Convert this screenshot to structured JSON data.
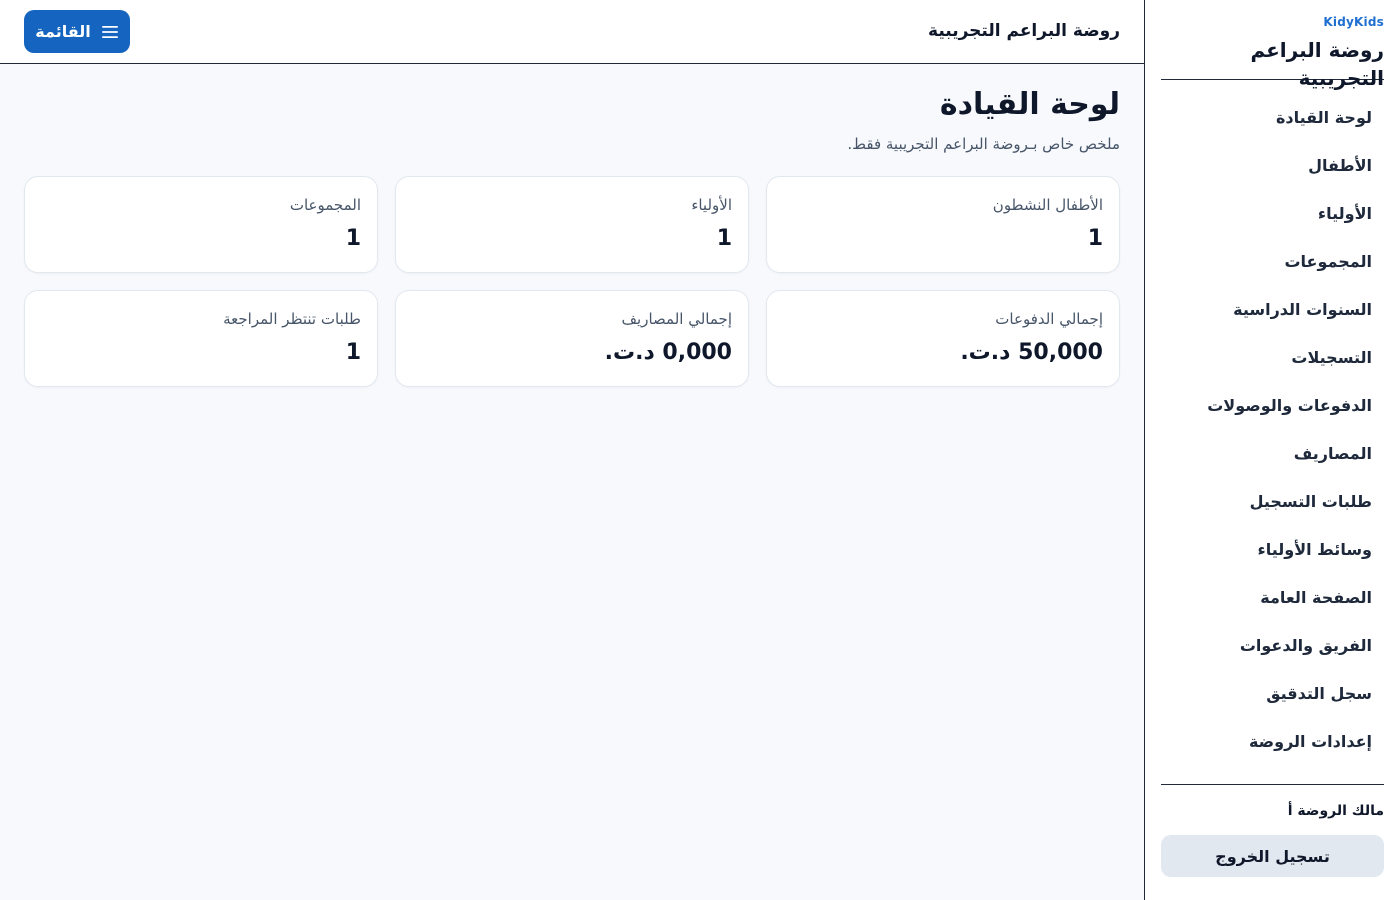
{
  "sidebar": {
    "brand_mark": "KidyKids",
    "brand_name": "روضة البراعم التجريبية",
    "items": [
      {
        "label": "لوحة القيادة"
      },
      {
        "label": "الأطفال"
      },
      {
        "label": "الأولياء"
      },
      {
        "label": "المجموعات"
      },
      {
        "label": "السنوات الدراسية"
      },
      {
        "label": "التسجيلات"
      },
      {
        "label": "الدفوعات والوصولات"
      },
      {
        "label": "المصاريف"
      },
      {
        "label": "طلبات التسجيل"
      },
      {
        "label": "وسائط الأولياء"
      },
      {
        "label": "الصفحة العامة"
      },
      {
        "label": "الفريق والدعوات"
      },
      {
        "label": "سجل التدقيق"
      },
      {
        "label": "إعدادات الروضة"
      }
    ],
    "owner": "مالك الروضة أ",
    "logout_label": "تسجيل الخروج"
  },
  "topbar": {
    "title": "روضة البراعم التجريبية",
    "menu_label": "القائمة",
    "menu_icon": "hamburger-icon"
  },
  "main": {
    "title": "لوحة القيادة",
    "subtitle": "ملخص خاص بـروضة البراعم التجريبية فقط.",
    "cards": [
      {
        "label": "الأطفال النشطون",
        "value": "1"
      },
      {
        "label": "الأولياء",
        "value": "1"
      },
      {
        "label": "المجموعات",
        "value": "1"
      },
      {
        "label": "إجمالي الدفوعات",
        "value": "50,000 د.ت."
      },
      {
        "label": "إجمالي المصاريف",
        "value": "0,000 د.ت."
      },
      {
        "label": "طلبات تنتظر المراجعة",
        "value": "1"
      }
    ]
  },
  "colors": {
    "accent": "#1565c0",
    "brand_mark": "#1f6fd1",
    "background": "#f7f9fc",
    "logout_bg": "#e2e8f0"
  }
}
